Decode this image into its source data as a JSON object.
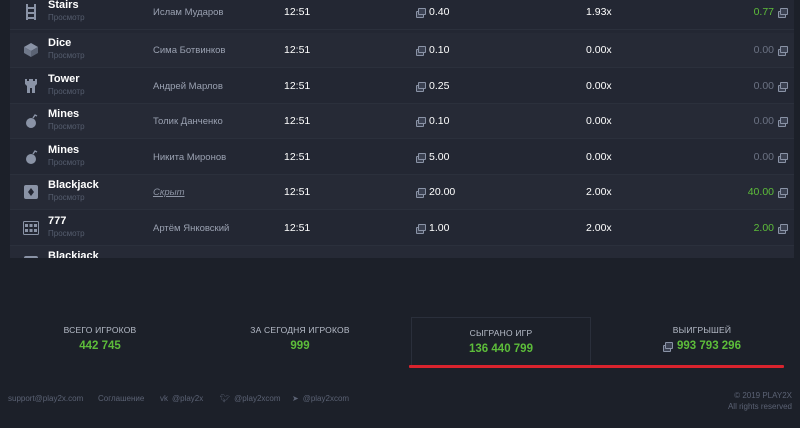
{
  "rows": [
    {
      "game": "Stairs",
      "sub": "Просмотр",
      "icon": "stairs-icon",
      "player": "Ислам Мударов",
      "hidden": false,
      "time": "12:51",
      "bet": "0.40",
      "coef": "1.93x",
      "win": "0.77",
      "win_positive": true
    },
    {
      "game": "Dice",
      "sub": "Просмотр",
      "icon": "dice-icon",
      "player": "Сима Ботвинков",
      "hidden": false,
      "time": "12:51",
      "bet": "0.10",
      "coef": "0.00x",
      "win": "0.00",
      "win_positive": false
    },
    {
      "game": "Tower",
      "sub": "Просмотр",
      "icon": "tower-icon",
      "player": "Андрей Марлов",
      "hidden": false,
      "time": "12:51",
      "bet": "0.25",
      "coef": "0.00x",
      "win": "0.00",
      "win_positive": false
    },
    {
      "game": "Mines",
      "sub": "Просмотр",
      "icon": "mine-icon",
      "player": "Толик Данченко",
      "hidden": false,
      "time": "12:51",
      "bet": "0.10",
      "coef": "0.00x",
      "win": "0.00",
      "win_positive": false
    },
    {
      "game": "Mines",
      "sub": "Просмотр",
      "icon": "mine-icon",
      "player": "Никита Миронов",
      "hidden": false,
      "time": "12:51",
      "bet": "5.00",
      "coef": "0.00x",
      "win": "0.00",
      "win_positive": false
    },
    {
      "game": "Blackjack",
      "sub": "Просмотр",
      "icon": "cards-icon",
      "player": "Скрыт",
      "hidden": true,
      "time": "12:51",
      "bet": "20.00",
      "coef": "2.00x",
      "win": "40.00",
      "win_positive": true
    },
    {
      "game": "777",
      "sub": "Просмотр",
      "icon": "slot-icon",
      "player": "Артём Янковский",
      "hidden": false,
      "time": "12:51",
      "bet": "1.00",
      "coef": "2.00x",
      "win": "2.00",
      "win_positive": true
    },
    {
      "game": "Blackjack",
      "sub": "",
      "icon": "cards-icon",
      "player": "",
      "hidden": false,
      "time": "",
      "bet": "",
      "coef": "",
      "win": "",
      "win_positive": false
    }
  ],
  "stats": {
    "total_players_label": "ВСЕГО ИГРОКОВ",
    "total_players_value": "442 745",
    "today_players_label": "ЗА СЕГОДНЯ ИГРОКОВ",
    "today_players_value": "999",
    "games_played_label": "СЫГРАНО ИГР",
    "games_played_value": "136 440 799",
    "winnings_label": "ВЫИГРЫШЕЙ",
    "winnings_value": "993 793 296"
  },
  "footer": {
    "email": "support@play2x.com",
    "agreement": "Соглашение",
    "vk": "@play2x",
    "twitter": "@play2xcom",
    "telegram": "@play2xcom",
    "copyright": "© 2019 PLAY2X",
    "rights": "All rights reserved"
  },
  "colors": {
    "accent_green": "#5dbd3a",
    "accent_red": "#d9232d",
    "background": "#1c2029",
    "panel": "#232733"
  }
}
